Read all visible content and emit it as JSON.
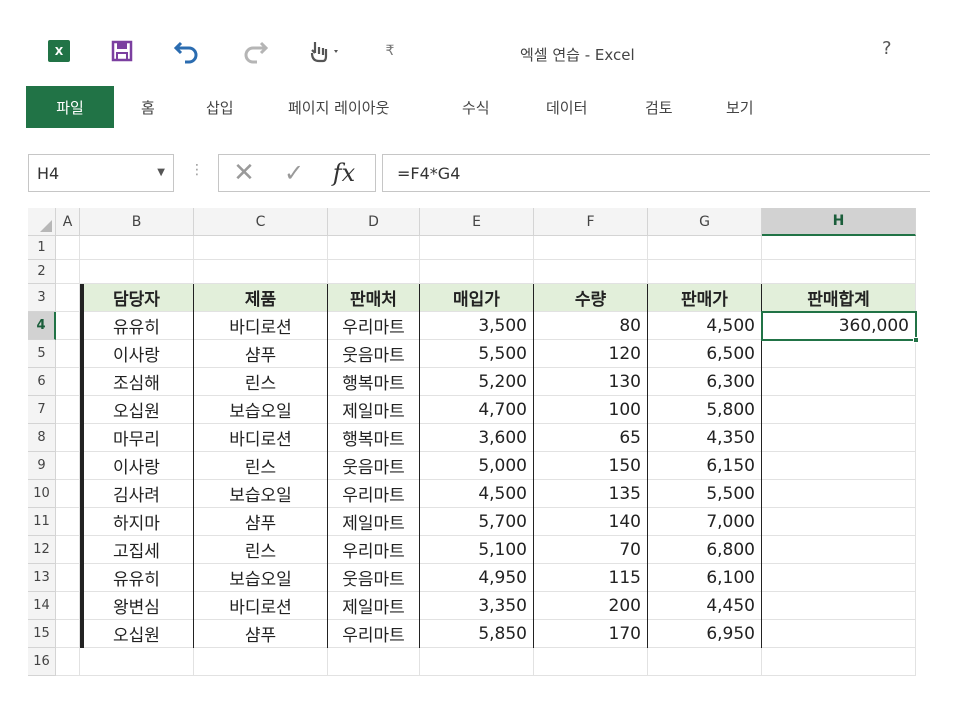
{
  "window": {
    "title": "엑셀 연습 - Excel",
    "help_label": "?",
    "logo_label": "X",
    "customize_label": "₹"
  },
  "ribbon": {
    "tabs": [
      "파일",
      "홈",
      "삽입",
      "페이지 레이아웃",
      "수식",
      "데이터",
      "검토",
      "보기"
    ]
  },
  "formula_bar": {
    "name_box": "H4",
    "formula": "=F4*G4",
    "fx_label": "fx"
  },
  "sheet": {
    "columns": [
      "A",
      "B",
      "C",
      "D",
      "E",
      "F",
      "G",
      "H"
    ],
    "rows": [
      "1",
      "2",
      "3",
      "4",
      "5",
      "6",
      "7",
      "8",
      "9",
      "10",
      "11",
      "12",
      "13",
      "14",
      "15",
      "16"
    ],
    "selected_cell": "H4",
    "header": [
      "담당자",
      "제품",
      "판매처",
      "매입가",
      "수량",
      "판매가",
      "판매합계"
    ],
    "data": [
      [
        "유유히",
        "바디로션",
        "우리마트",
        "3,500",
        "80",
        "4,500",
        "360,000"
      ],
      [
        "이사랑",
        "샴푸",
        "웃음마트",
        "5,500",
        "120",
        "6,500",
        ""
      ],
      [
        "조심해",
        "린스",
        "행복마트",
        "5,200",
        "130",
        "6,300",
        ""
      ],
      [
        "오십원",
        "보습오일",
        "제일마트",
        "4,700",
        "100",
        "5,800",
        ""
      ],
      [
        "마무리",
        "바디로션",
        "행복마트",
        "3,600",
        "65",
        "4,350",
        ""
      ],
      [
        "이사랑",
        "린스",
        "웃음마트",
        "5,000",
        "150",
        "6,150",
        ""
      ],
      [
        "김사려",
        "보습오일",
        "우리마트",
        "4,500",
        "135",
        "5,500",
        ""
      ],
      [
        "하지마",
        "샴푸",
        "제일마트",
        "5,700",
        "140",
        "7,000",
        ""
      ],
      [
        "고집세",
        "린스",
        "우리마트",
        "5,100",
        "70",
        "6,800",
        ""
      ],
      [
        "유유히",
        "보습오일",
        "웃음마트",
        "4,950",
        "115",
        "6,100",
        ""
      ],
      [
        "왕변심",
        "바디로션",
        "제일마트",
        "3,350",
        "200",
        "4,450",
        ""
      ],
      [
        "오십원",
        "샴푸",
        "우리마트",
        "5,850",
        "170",
        "6,950",
        ""
      ]
    ]
  },
  "colors": {
    "accent": "#217346",
    "header_fill": "#e2efda",
    "save_icon": "#7b3fa0",
    "undo_icon": "#2b6cb0"
  },
  "icons": {
    "logo": "excel-logo-icon",
    "save": "save-icon",
    "undo": "undo-icon",
    "redo": "redo-icon",
    "touch": "touch-mode-icon",
    "cancel": "cancel-icon",
    "enter": "enter-icon",
    "fx": "function-icon"
  }
}
